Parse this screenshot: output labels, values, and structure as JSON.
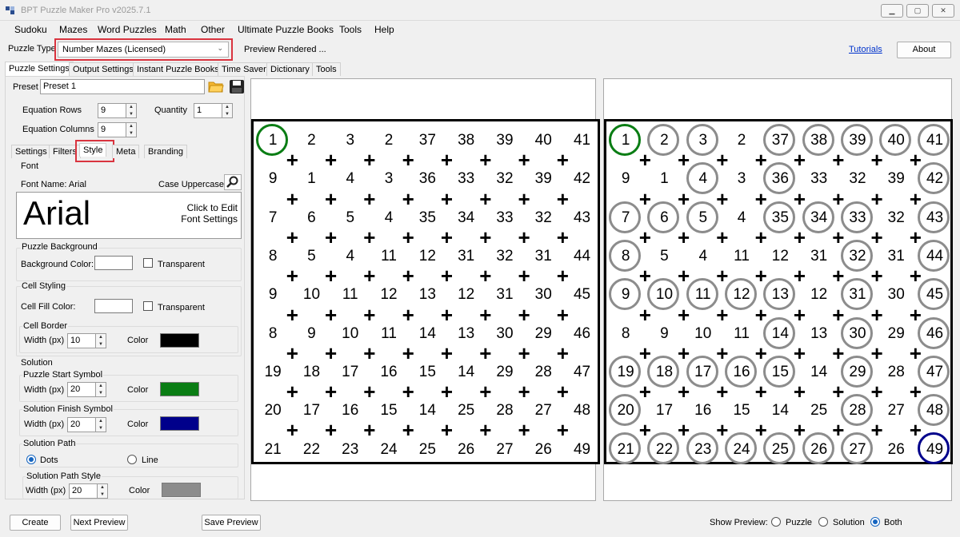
{
  "window": {
    "title": "BPT Puzzle Maker Pro v2025.7.1"
  },
  "menu": [
    "Sudoku",
    "Mazes",
    "Word Puzzles",
    "Math",
    "Other",
    "Ultimate Puzzle Books",
    "Tools",
    "Help"
  ],
  "toolbar": {
    "puzzle_type_label": "Puzzle Type",
    "puzzle_type_value": "Number Mazes (Licensed)",
    "preview_status": "Preview Rendered ...",
    "tutorials_link": "Tutorials",
    "about_button": "About"
  },
  "main_tabs": [
    "Puzzle Settings",
    "Output Settings",
    "Instant Puzzle Books",
    "Time Saver",
    "Dictionary",
    "Tools"
  ],
  "settings": {
    "preset_label": "Preset",
    "preset_value": "Preset 1",
    "equation_rows_label": "Equation Rows",
    "equation_rows_value": "9",
    "quantity_label": "Quantity",
    "quantity_value": "1",
    "equation_columns_label": "Equation Columns",
    "equation_columns_value": "9",
    "sub_tabs": [
      "Settings",
      "Filters",
      "Style",
      "Meta",
      "Branding"
    ],
    "font_group": "Font",
    "font_name": "Font Name: Arial",
    "case_label": "Case Uppercase",
    "font_sample": "Arial",
    "font_edit_hint": "Click to Edit\nFont Settings",
    "bg_group": "Puzzle Background",
    "bg_color_label": "Background Color:",
    "transparent_label": "Transparent",
    "cell_group": "Cell Styling",
    "cell_fill_label": "Cell Fill Color:",
    "cell_border_group": "Cell Border",
    "width_px_label": "Width (px)",
    "color_label": "Color",
    "cell_border_width": "10",
    "solution_group": "Solution",
    "start_symbol_group": "Puzzle Start Symbol",
    "start_width": "20",
    "finish_symbol_group": "Solution Finish Symbol",
    "finish_width": "20",
    "path_group": "Solution Path",
    "dots_label": "Dots",
    "line_label": "Line",
    "path_style_group": "Solution Path Style",
    "path_width": "20",
    "colors": {
      "cell_border": "#000000",
      "start": "#0a7d14",
      "finish": "#00008b",
      "path": "#8c8c8c"
    }
  },
  "puzzle": {
    "rows": [
      [
        "1",
        "2",
        "3",
        "2",
        "37",
        "38",
        "39",
        "40",
        "41"
      ],
      [
        "9",
        "1",
        "4",
        "3",
        "36",
        "33",
        "32",
        "39",
        "42"
      ],
      [
        "7",
        "6",
        "5",
        "4",
        "35",
        "34",
        "33",
        "32",
        "43"
      ],
      [
        "8",
        "5",
        "4",
        "11",
        "12",
        "31",
        "32",
        "31",
        "44"
      ],
      [
        "9",
        "10",
        "11",
        "12",
        "13",
        "12",
        "31",
        "30",
        "45"
      ],
      [
        "8",
        "9",
        "10",
        "11",
        "14",
        "13",
        "30",
        "29",
        "46"
      ],
      [
        "19",
        "18",
        "17",
        "16",
        "15",
        "14",
        "29",
        "28",
        "47"
      ],
      [
        "20",
        "17",
        "16",
        "15",
        "14",
        "25",
        "28",
        "27",
        "48"
      ],
      [
        "21",
        "22",
        "23",
        "24",
        "25",
        "26",
        "27",
        "26",
        "49"
      ]
    ],
    "solution_path": [
      [
        0,
        0
      ],
      [
        0,
        1
      ],
      [
        0,
        2
      ],
      [
        1,
        2
      ],
      [
        2,
        2
      ],
      [
        2,
        1
      ],
      [
        2,
        0
      ],
      [
        3,
        0
      ],
      [
        4,
        0
      ],
      [
        4,
        1
      ],
      [
        4,
        2
      ],
      [
        4,
        3
      ],
      [
        4,
        4
      ],
      [
        5,
        4
      ],
      [
        6,
        4
      ],
      [
        6,
        3
      ],
      [
        6,
        2
      ],
      [
        6,
        1
      ],
      [
        6,
        0
      ],
      [
        7,
        0
      ],
      [
        8,
        0
      ],
      [
        8,
        1
      ],
      [
        8,
        2
      ],
      [
        8,
        3
      ],
      [
        8,
        4
      ],
      [
        8,
        5
      ],
      [
        8,
        6
      ],
      [
        7,
        6
      ],
      [
        6,
        6
      ],
      [
        5,
        6
      ],
      [
        4,
        6
      ],
      [
        3,
        6
      ],
      [
        2,
        6
      ],
      [
        2,
        5
      ],
      [
        2,
        4
      ],
      [
        1,
        4
      ],
      [
        0,
        4
      ],
      [
        0,
        5
      ],
      [
        0,
        6
      ],
      [
        0,
        7
      ],
      [
        0,
        8
      ],
      [
        1,
        8
      ],
      [
        2,
        8
      ],
      [
        3,
        8
      ],
      [
        4,
        8
      ],
      [
        5,
        8
      ],
      [
        6,
        8
      ],
      [
        7,
        8
      ],
      [
        8,
        8
      ]
    ]
  },
  "bottom": {
    "create_button": "Create",
    "next_preview_button": "Next Preview",
    "save_preview_button": "Save Preview",
    "show_preview_label": "Show Preview:",
    "options": [
      "Puzzle",
      "Solution",
      "Both"
    ],
    "selected": "Both"
  }
}
